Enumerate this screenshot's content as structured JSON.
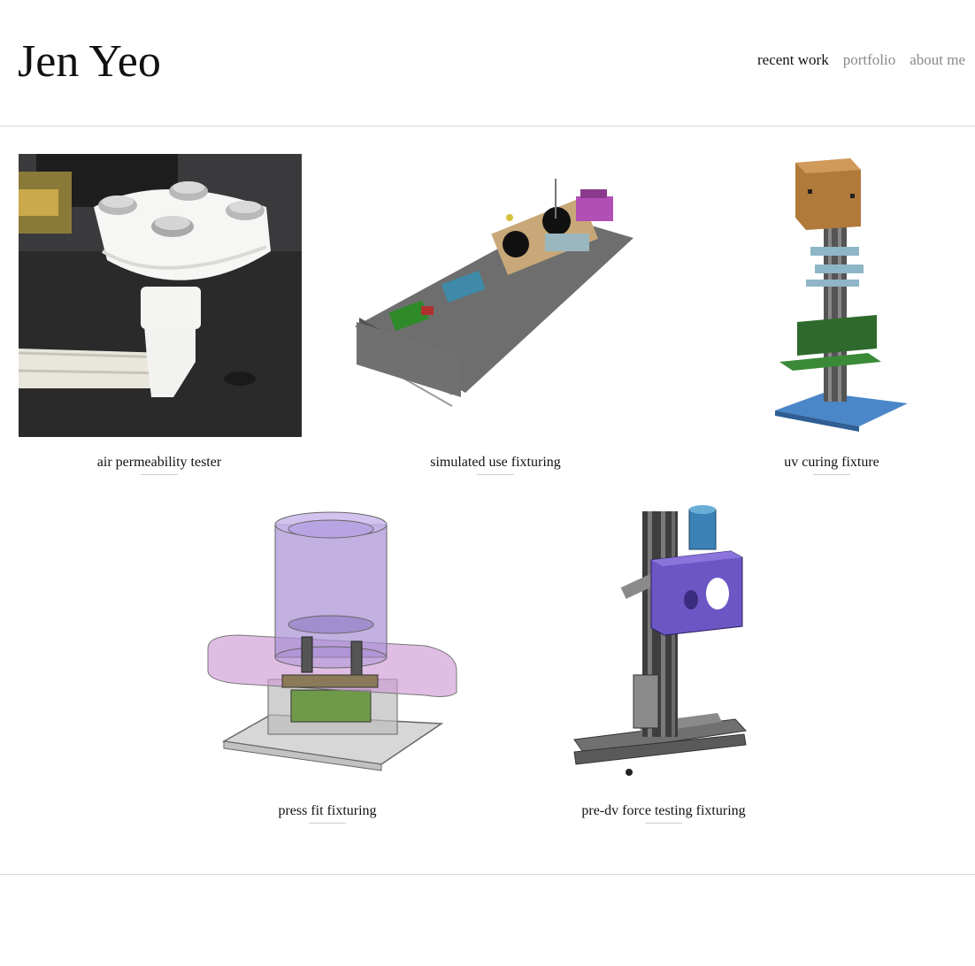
{
  "site": {
    "title": "Jen Yeo"
  },
  "nav": {
    "items": [
      {
        "label": "recent work",
        "active": true
      },
      {
        "label": "portfolio",
        "active": false
      },
      {
        "label": "about me",
        "active": false
      }
    ]
  },
  "gallery": {
    "items": [
      {
        "caption": "air permeability tester"
      },
      {
        "caption": "simulated use fixturing"
      },
      {
        "caption": "uv curing fixture"
      },
      {
        "caption": "press fit fixturing"
      },
      {
        "caption": "pre-dv force testing fixturing"
      }
    ]
  },
  "colors": {
    "text": "#111111",
    "muted": "#888888",
    "rule": "#d8d8d8"
  }
}
